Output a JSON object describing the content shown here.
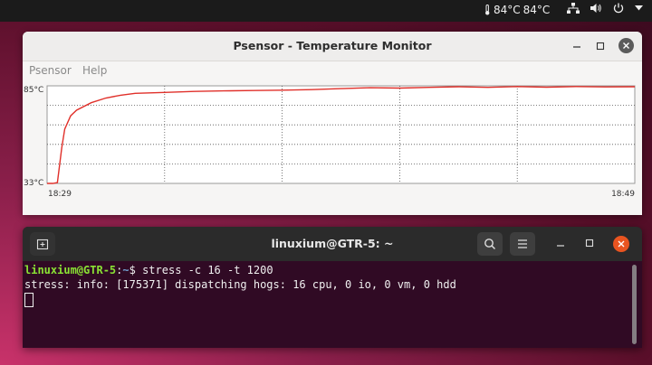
{
  "topbar": {
    "temp1": "84°C",
    "temp2": "84°C",
    "icons": [
      "thermometer-icon",
      "network-icon",
      "volume-icon",
      "power-icon",
      "chevron-down-icon"
    ]
  },
  "psensor": {
    "title": "Psensor - Temperature Monitor",
    "menu": [
      "Psensor",
      "Help"
    ],
    "chart_data": {
      "type": "line",
      "ymax_label": "85°C",
      "ymin_label": "33°C",
      "ylim": [
        33,
        85
      ],
      "xstart_label": "18:29",
      "xend_label": "18:49",
      "grid": true,
      "color": "#e0302a",
      "series": [
        {
          "x": [
            0,
            0.2,
            0.35,
            0.5,
            0.6,
            0.8,
            1,
            1.5,
            2,
            2.5,
            3,
            4,
            5,
            6,
            7,
            8,
            9,
            10,
            11,
            12,
            13,
            14,
            15,
            16,
            17,
            18,
            19,
            20
          ],
          "values": [
            33,
            33,
            33.5,
            52,
            62,
            69,
            72,
            76,
            78.5,
            80,
            81,
            81.5,
            82,
            82.3,
            82.5,
            82.7,
            83,
            83.5,
            84,
            83.8,
            84.2,
            84.5,
            84.2,
            84.6,
            84.3,
            84.6,
            84.4,
            84.5
          ]
        }
      ]
    }
  },
  "terminal": {
    "title": "linuxium@GTR-5: ~",
    "prompt_user": "linuxium@GTR-5",
    "prompt_sep": ":",
    "prompt_path": "~",
    "prompt_dollar": "$ ",
    "command": "stress -c 16 -t 1200",
    "output": "stress: info: [175371] dispatching hogs: 16 cpu, 0 io, 0 vm, 0 hdd"
  },
  "colors": {
    "accent": "#e95420",
    "terminal_bg": "#300a24",
    "line": "#e0302a"
  }
}
